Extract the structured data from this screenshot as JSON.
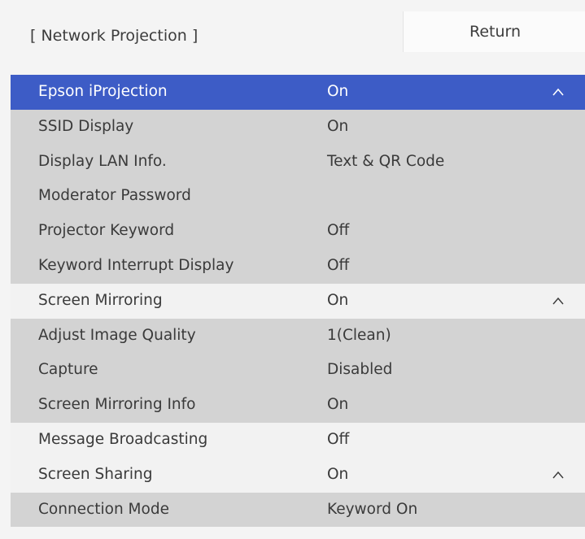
{
  "header": {
    "title": "[ Network Projection ]",
    "return_label": "Return"
  },
  "rows": [
    {
      "label": "Epson iProjection",
      "value": "On",
      "style": "selected",
      "chevron": "chevron-up-icon"
    },
    {
      "label": "SSID Display",
      "value": "On",
      "style": "gray"
    },
    {
      "label": "Display LAN Info.",
      "value": "Text & QR Code",
      "style": "gray"
    },
    {
      "label": "Moderator Password",
      "value": "",
      "style": "gray"
    },
    {
      "label": "Projector Keyword",
      "value": "Off",
      "style": "gray"
    },
    {
      "label": "Keyword Interrupt Display",
      "value": "Off",
      "style": "gray"
    },
    {
      "label": "Screen Mirroring",
      "value": "On",
      "style": "light",
      "chevron": "chevron-up-icon"
    },
    {
      "label": "Adjust Image Quality",
      "value": "1(Clean)",
      "style": "gray"
    },
    {
      "label": "Capture",
      "value": "Disabled",
      "style": "gray"
    },
    {
      "label": "Screen Mirroring Info",
      "value": "On",
      "style": "gray"
    },
    {
      "label": "Message Broadcasting",
      "value": "Off",
      "style": "light"
    },
    {
      "label": "Screen Sharing",
      "value": "On",
      "style": "light",
      "chevron": "chevron-up-icon"
    },
    {
      "label": "Connection Mode",
      "value": "Keyword On",
      "style": "gray"
    }
  ],
  "colors": {
    "selected": "#3d5cc6",
    "row_gray": "#d3d3d3",
    "row_light": "#f2f2f2",
    "background": "#f4f4f4"
  }
}
